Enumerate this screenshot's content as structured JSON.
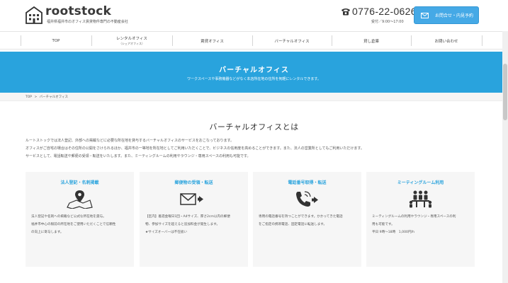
{
  "header": {
    "logo": "rootstock",
    "logo_sub": "福井県福井市のオフィス賃貸物件専門の不動産会社",
    "phone": "0776-22-0626",
    "hours": "受付／9:00〜17:00",
    "contact_label": "お問合せ・内見予約"
  },
  "nav": {
    "items": [
      {
        "label": "TOP",
        "sub": ""
      },
      {
        "label": "レンタルオフィス",
        "sub": "（シェアオフィス）"
      },
      {
        "label": "賃貸オフィス",
        "sub": ""
      },
      {
        "label": "バーチャルオフィス",
        "sub": ""
      },
      {
        "label": "貸し倉庫",
        "sub": ""
      },
      {
        "label": "お問い合わせ",
        "sub": ""
      }
    ]
  },
  "hero": {
    "title": "バーチャルオフィス",
    "subtitle": "ワークスペースや事務機器などがなく本店所在地の住所を気軽にレンタルできます。"
  },
  "breadcrumb": {
    "home": "TOP",
    "sep": ">",
    "current": "バーチャルオフィス"
  },
  "section": {
    "title": "バーチャルオフィスとは",
    "intro_1": "ルートストックでは法人登記、外部への掲載などに必要な所在地を貸与するバーチャルオフィスのサービスをおこなっております。",
    "intro_2": "オフィスがご自宅の場合はその住所の公開をさけられるほか、福井市の一等地を所在地としてご利用いただくことで、ビジネスの信用度を高めることができます。また、法人の営業所としてもご利用いただけます。",
    "intro_3": "サービスとして、電話転送や郵便の受領・転送をいたします。また、ミーティングルームの利用やラウンジ・専用スペースの利用も可能です。"
  },
  "cards": [
    {
      "title": "法人登記・名刺掲載",
      "icon": "map-pin-icon",
      "text_1": "法人登記や名刺への掲載など公式な所在地を貸与。",
      "text_2": "福井市中心の駅前の所在地をご使用いただくことで信頼性",
      "text_3": "の向上に寄与します。"
    },
    {
      "title": "郵便物の受領・転送",
      "icon": "envelope-arrow-icon",
      "text_1": "【区内】着週金曜日1回・A4サイズ、厚さ2cm以内の郵便",
      "text_2": "物、参加サイズを超えると追加料金が発生します。",
      "text_3": "★サイズオーバーは不在扱い"
    },
    {
      "title": "電話番号取得・転送",
      "icon": "phone-arrow-icon",
      "text_1": "専用の電話番号を持つことができます。かかってきた電話",
      "text_2": "をご指定の携帯電話、固定電話に転送します。",
      "text_3": ""
    },
    {
      "title": "ミーティングルーム利用",
      "icon": "meeting-people-icon",
      "text_1": "ミーティングルームの利用やラウンジ・専用スペースの利",
      "text_2": "用も可能です。",
      "text_3": "平日 9時〜18時　1,000円/h"
    }
  ],
  "colors": {
    "accent": "#29a3dd",
    "button": "#45a9e6",
    "card_bg": "#f6f6f6"
  }
}
